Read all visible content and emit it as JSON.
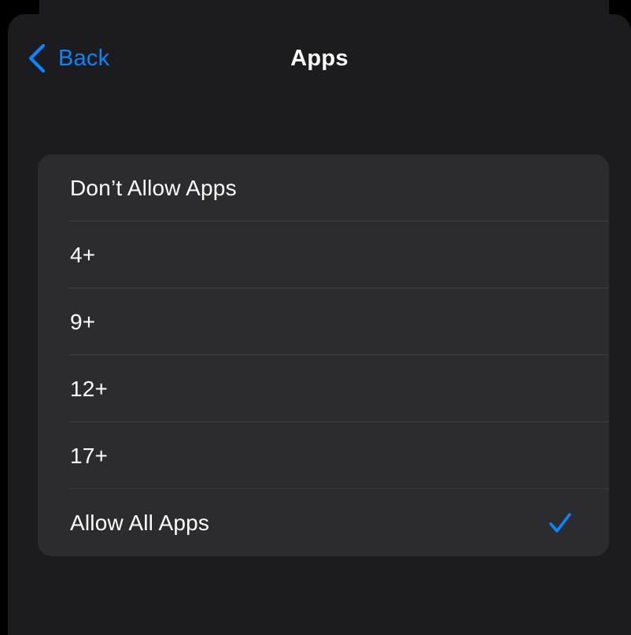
{
  "nav": {
    "back_label": "Back",
    "back_icon": "chevron-left-icon",
    "title": "Apps"
  },
  "options": [
    {
      "label": "Don’t Allow Apps",
      "selected": false
    },
    {
      "label": "4+",
      "selected": false
    },
    {
      "label": "9+",
      "selected": false
    },
    {
      "label": "12+",
      "selected": false
    },
    {
      "label": "17+",
      "selected": false
    },
    {
      "label": "Allow All Apps",
      "selected": true
    }
  ],
  "selection_icon": "checkmark-icon",
  "colors": {
    "accent": "#0a84ff",
    "background": "#000000",
    "sheet": "#1c1c1e",
    "group": "#2c2c2e",
    "text": "#ffffff",
    "separator": "#3d3d40"
  }
}
